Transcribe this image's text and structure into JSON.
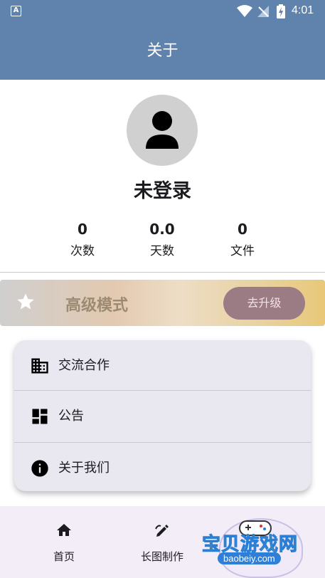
{
  "status_bar": {
    "app_badge": "A",
    "time": "4:01",
    "icons": [
      "wifi-icon",
      "no-signal-icon",
      "battery-charging-icon"
    ]
  },
  "app_bar": {
    "title": "关于"
  },
  "profile": {
    "avatar_icon": "person-icon",
    "username": "未登录",
    "stats": [
      {
        "value": "0",
        "label": "次数"
      },
      {
        "value": "0.0",
        "label": "天数"
      },
      {
        "value": "0",
        "label": "文件"
      }
    ]
  },
  "premium": {
    "icon": "star-icon",
    "title": "高级模式",
    "button_label": "去升级"
  },
  "menu": {
    "items": [
      {
        "icon": "building-icon",
        "label": "交流合作"
      },
      {
        "icon": "dashboard-icon",
        "label": "公告"
      },
      {
        "icon": "info-icon",
        "label": "关于我们"
      }
    ]
  },
  "bottom_nav": {
    "items": [
      {
        "icon": "home-icon",
        "label": "首页"
      },
      {
        "icon": "draw-icon",
        "label": "长图制作"
      }
    ]
  },
  "watermark": {
    "text": "宝贝游戏网",
    "url": "baobeiy.com"
  },
  "colors": {
    "primary": "#5f83ad",
    "menu_bg": "#e9e7f0",
    "nav_bg": "#f3edf7",
    "upgrade_button": "#9c7c84"
  }
}
